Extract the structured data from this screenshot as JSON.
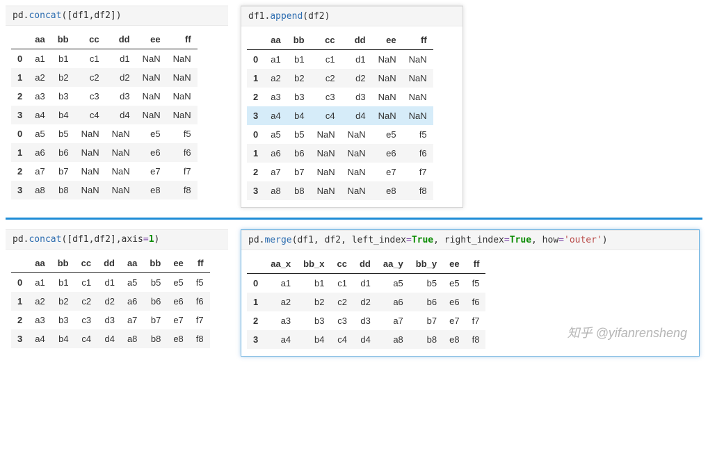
{
  "watermark": "知乎 @yifanrensheng",
  "panels": {
    "p1": {
      "tokens": [
        "pd",
        ".",
        "concat",
        "([df1,df2])"
      ],
      "token_classes": [
        "plain",
        "plain",
        "call",
        "plain"
      ],
      "headers": [
        "",
        "aa",
        "bb",
        "cc",
        "dd",
        "ee",
        "ff"
      ],
      "rows": [
        {
          "idx": "0",
          "cells": [
            "a1",
            "b1",
            "c1",
            "d1",
            "NaN",
            "NaN"
          ],
          "cls": ""
        },
        {
          "idx": "1",
          "cells": [
            "a2",
            "b2",
            "c2",
            "d2",
            "NaN",
            "NaN"
          ],
          "cls": "alt"
        },
        {
          "idx": "2",
          "cells": [
            "a3",
            "b3",
            "c3",
            "d3",
            "NaN",
            "NaN"
          ],
          "cls": ""
        },
        {
          "idx": "3",
          "cells": [
            "a4",
            "b4",
            "c4",
            "d4",
            "NaN",
            "NaN"
          ],
          "cls": "alt"
        },
        {
          "idx": "0",
          "cells": [
            "a5",
            "b5",
            "NaN",
            "NaN",
            "e5",
            "f5"
          ],
          "cls": ""
        },
        {
          "idx": "1",
          "cells": [
            "a6",
            "b6",
            "NaN",
            "NaN",
            "e6",
            "f6"
          ],
          "cls": "alt"
        },
        {
          "idx": "2",
          "cells": [
            "a7",
            "b7",
            "NaN",
            "NaN",
            "e7",
            "f7"
          ],
          "cls": ""
        },
        {
          "idx": "3",
          "cells": [
            "a8",
            "b8",
            "NaN",
            "NaN",
            "e8",
            "f8"
          ],
          "cls": "alt"
        }
      ]
    },
    "p2": {
      "tokens": [
        "df1",
        ".",
        "append",
        "(df2)"
      ],
      "token_classes": [
        "plain",
        "plain",
        "call",
        "plain"
      ],
      "headers": [
        "",
        "aa",
        "bb",
        "cc",
        "dd",
        "ee",
        "ff"
      ],
      "rows": [
        {
          "idx": "0",
          "cells": [
            "a1",
            "b1",
            "c1",
            "d1",
            "NaN",
            "NaN"
          ],
          "cls": ""
        },
        {
          "idx": "1",
          "cells": [
            "a2",
            "b2",
            "c2",
            "d2",
            "NaN",
            "NaN"
          ],
          "cls": "alt"
        },
        {
          "idx": "2",
          "cells": [
            "a3",
            "b3",
            "c3",
            "d3",
            "NaN",
            "NaN"
          ],
          "cls": ""
        },
        {
          "idx": "3",
          "cells": [
            "a4",
            "b4",
            "c4",
            "d4",
            "NaN",
            "NaN"
          ],
          "cls": "hl"
        },
        {
          "idx": "0",
          "cells": [
            "a5",
            "b5",
            "NaN",
            "NaN",
            "e5",
            "f5"
          ],
          "cls": ""
        },
        {
          "idx": "1",
          "cells": [
            "a6",
            "b6",
            "NaN",
            "NaN",
            "e6",
            "f6"
          ],
          "cls": "alt"
        },
        {
          "idx": "2",
          "cells": [
            "a7",
            "b7",
            "NaN",
            "NaN",
            "e7",
            "f7"
          ],
          "cls": ""
        },
        {
          "idx": "3",
          "cells": [
            "a8",
            "b8",
            "NaN",
            "NaN",
            "e8",
            "f8"
          ],
          "cls": "alt"
        }
      ]
    },
    "p3": {
      "tokens": [
        "pd",
        ".",
        "concat",
        "([df1,df2],axis",
        "=",
        "1",
        ")"
      ],
      "token_classes": [
        "plain",
        "plain",
        "call",
        "plain",
        "op",
        "kw",
        "plain"
      ],
      "headers": [
        "",
        "aa",
        "bb",
        "cc",
        "dd",
        "aa",
        "bb",
        "ee",
        "ff"
      ],
      "rows": [
        {
          "idx": "0",
          "cells": [
            "a1",
            "b1",
            "c1",
            "d1",
            "a5",
            "b5",
            "e5",
            "f5"
          ],
          "cls": ""
        },
        {
          "idx": "1",
          "cells": [
            "a2",
            "b2",
            "c2",
            "d2",
            "a6",
            "b6",
            "e6",
            "f6"
          ],
          "cls": "alt"
        },
        {
          "idx": "2",
          "cells": [
            "a3",
            "b3",
            "c3",
            "d3",
            "a7",
            "b7",
            "e7",
            "f7"
          ],
          "cls": ""
        },
        {
          "idx": "3",
          "cells": [
            "a4",
            "b4",
            "c4",
            "d4",
            "a8",
            "b8",
            "e8",
            "f8"
          ],
          "cls": "alt"
        }
      ]
    },
    "p4": {
      "tokens": [
        "pd",
        ".",
        "merge",
        "(df1, df2, left_index",
        "=",
        "True",
        ", right_index",
        "=",
        "True",
        ", how",
        "=",
        "'outer'",
        ")"
      ],
      "token_classes": [
        "plain",
        "plain",
        "call",
        "plain",
        "op",
        "kw",
        "plain",
        "op",
        "kw",
        "plain",
        "op",
        "str",
        "plain"
      ],
      "headers": [
        "",
        "aa_x",
        "bb_x",
        "cc",
        "dd",
        "aa_y",
        "bb_y",
        "ee",
        "ff"
      ],
      "rows": [
        {
          "idx": "0",
          "cells": [
            "a1",
            "b1",
            "c1",
            "d1",
            "a5",
            "b5",
            "e5",
            "f5"
          ],
          "cls": ""
        },
        {
          "idx": "1",
          "cells": [
            "a2",
            "b2",
            "c2",
            "d2",
            "a6",
            "b6",
            "e6",
            "f6"
          ],
          "cls": "alt"
        },
        {
          "idx": "2",
          "cells": [
            "a3",
            "b3",
            "c3",
            "d3",
            "a7",
            "b7",
            "e7",
            "f7"
          ],
          "cls": ""
        },
        {
          "idx": "3",
          "cells": [
            "a4",
            "b4",
            "c4",
            "d4",
            "a8",
            "b8",
            "e8",
            "f8"
          ],
          "cls": "alt"
        }
      ]
    }
  }
}
